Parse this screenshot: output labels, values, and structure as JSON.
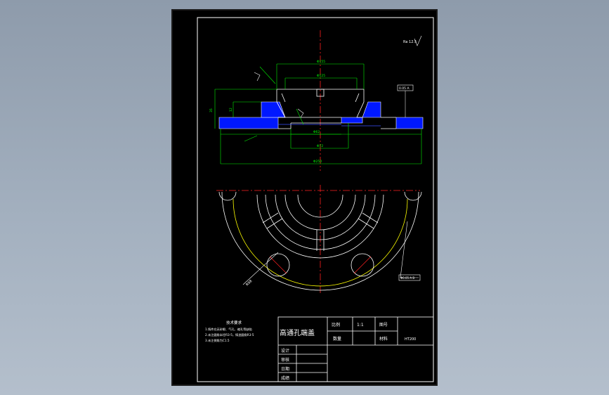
{
  "drawing": {
    "part_title": "高通孔端盖",
    "roughness_note": "Ra 12.5",
    "tolerance_box": "0.05 A",
    "position_box": "Φ0.05 A B",
    "dims": {
      "d_top": "Φ155",
      "d_mid": "Φ125",
      "d_inner": "Φ62",
      "d_bore": "Φ72",
      "d_base": "Φ180",
      "d_outer": "Φ250",
      "h_total": "35",
      "h_step": "12",
      "pcd": "R98"
    },
    "tech_requirements": {
      "heading": "技术要求",
      "items": [
        "1.铸件应无砂眼、气孔、缩孔等缺陷",
        "2.未注圆角半径R3-5，铸造圆角R3-5",
        "3.未注倒角为C1.5"
      ]
    },
    "title_block": {
      "scale_label": "比例",
      "scale_value": "1:1",
      "drawing_no_label": "图号",
      "qty_label": "数量",
      "material_label": "材料",
      "material_value": "HT200",
      "design_label": "设计",
      "check_label": "审核",
      "date_label": "日期",
      "grade_label": "成绩"
    }
  },
  "colors": {
    "background": "#000000",
    "section_fill": "#0000ff",
    "dimension": "#00ff00",
    "centerline": "#ff0000",
    "outline": "#ffffff",
    "circle": "#ffff00"
  }
}
